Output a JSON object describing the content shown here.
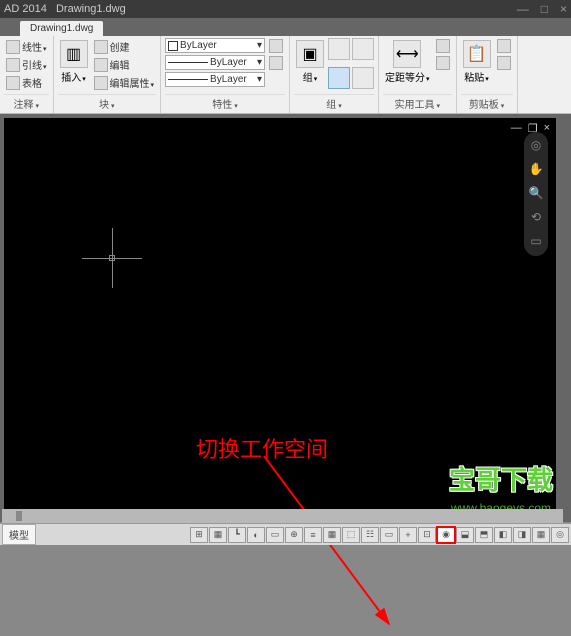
{
  "app": {
    "suffix": "AD 2014",
    "file": "Drawing1.dwg"
  },
  "ribbon": {
    "draw": {
      "linear": "线性",
      "leader": "引线",
      "table": "表格",
      "label": "注释"
    },
    "insert": {
      "btn": "插入",
      "create": "创建",
      "edit": "编辑",
      "editattr": "编辑属性",
      "label": "块"
    },
    "props": {
      "bylayer1": "ByLayer",
      "bylayer2": "ByLayer",
      "bylayer3": "ByLayer",
      "label": "特性"
    },
    "group": {
      "btn": "组",
      "label": "组"
    },
    "util": {
      "measure": "定距等分",
      "label": "实用工具"
    },
    "clip": {
      "paste": "粘贴",
      "label": "剪贴板"
    }
  },
  "annotation": "切换工作空间",
  "watermark": {
    "big": "宝哥下载",
    "small": "www.baogeys.com"
  },
  "status": {
    "tab": "模型",
    "buttons": [
      "⊞",
      "▦",
      "┗",
      "◐",
      "▭",
      "⊕",
      "≡",
      "▦",
      "⬚",
      "☷",
      "▭",
      "+",
      "⊡",
      "◉",
      "⬓",
      "⬒",
      "◧",
      "◨",
      "▦",
      "◎"
    ]
  }
}
